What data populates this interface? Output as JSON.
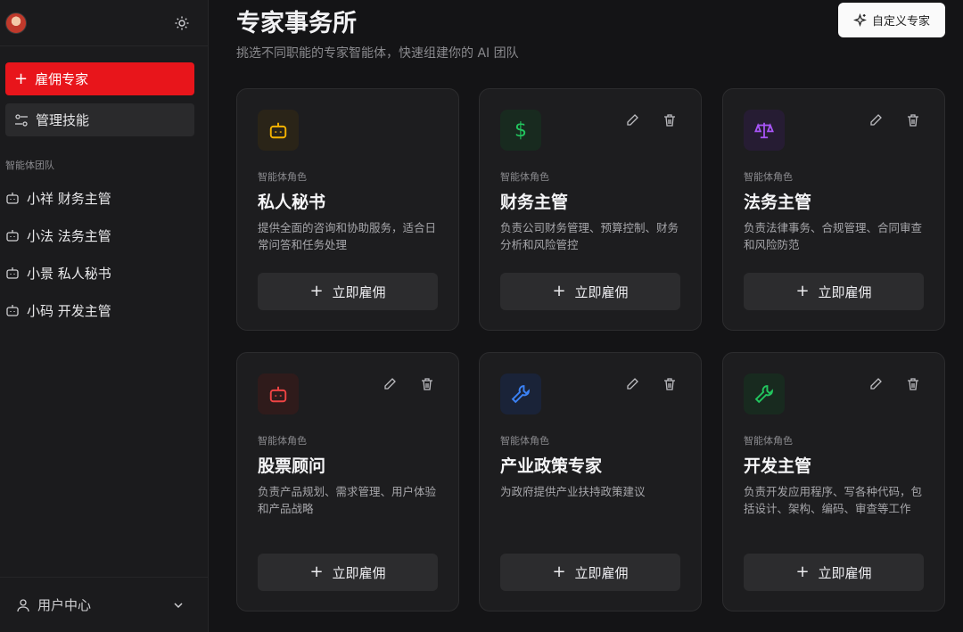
{
  "sidebar": {
    "hire_label": "雇佣专家",
    "skills_label": "管理技能",
    "section_label": "智能体团队",
    "team": [
      {
        "label": "小祥 财务主管"
      },
      {
        "label": "小法 法务主管"
      },
      {
        "label": "小景 私人秘书"
      },
      {
        "label": "小码 开发主管"
      }
    ],
    "user_center": "用户中心"
  },
  "main": {
    "title": "专家事务所",
    "subtitle": "挑选不同职能的专家智能体，快速组建你的 AI 团队",
    "custom_button": "自定义专家",
    "cards": [
      {
        "role": "智能体角色",
        "name": "私人秘书",
        "desc": "提供全面的咨询和协助服务，适合日常问答和任务处理",
        "hire": "立即雇佣",
        "icon": "robot-icon",
        "color": "#f5b301"
      },
      {
        "role": "智能体角色",
        "name": "财务主管",
        "desc": "负责公司财务管理、预算控制、财务分析和风险管控",
        "hire": "立即雇佣",
        "icon": "dollar-icon",
        "color": "#22c55e"
      },
      {
        "role": "智能体角色",
        "name": "法务主管",
        "desc": "负责法律事务、合规管理、合同审查和风险防范",
        "hire": "立即雇佣",
        "icon": "scale-icon",
        "color": "#a855f7"
      },
      {
        "role": "智能体角色",
        "name": "股票顾问",
        "desc": "负责产品规划、需求管理、用户体验和产品战略",
        "hire": "立即雇佣",
        "icon": "robot-icon",
        "color": "#ef4444"
      },
      {
        "role": "智能体角色",
        "name": "产业政策专家",
        "desc": "为政府提供产业扶持政策建议",
        "hire": "立即雇佣",
        "icon": "wrench-icon",
        "color": "#3b82f6"
      },
      {
        "role": "智能体角色",
        "name": "开发主管",
        "desc": "负责开发应用程序、写各种代码，包括设计、架构、编码、审查等工作",
        "hire": "立即雇佣",
        "icon": "wrench-icon",
        "color": "#22c55e"
      }
    ]
  }
}
